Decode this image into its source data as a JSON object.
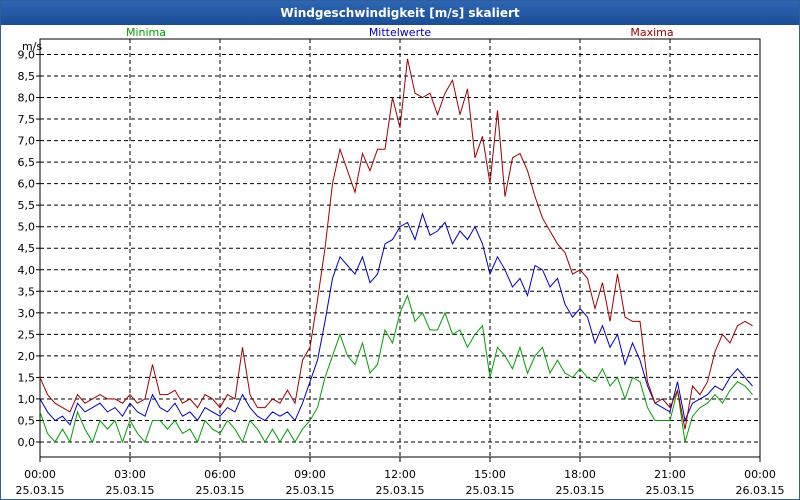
{
  "window": {
    "title": "Windgeschwindigkeit [m/s] skaliert"
  },
  "chart_data": {
    "type": "line",
    "title": "Windgeschwindigkeit [m/s] skaliert",
    "ylabel": "m/s",
    "xlabel": "",
    "ylim": [
      0,
      9.2
    ],
    "xlim": [
      0,
      24
    ],
    "grid": true,
    "legend_position": "top",
    "y_ticks": [
      "0,0",
      "0,5",
      "1,0",
      "1,5",
      "2,0",
      "2,5",
      "3,0",
      "3,5",
      "4,0",
      "4,5",
      "5,0",
      "5,5",
      "6,0",
      "6,5",
      "7,0",
      "7,5",
      "8,0",
      "8,5",
      "9,0"
    ],
    "x_ticks": [
      {
        "time": "00:00",
        "date": "25.03.15"
      },
      {
        "time": "03:00",
        "date": "25.03.15"
      },
      {
        "time": "06:00",
        "date": "25.03.15"
      },
      {
        "time": "09:00",
        "date": "25.03.15"
      },
      {
        "time": "12:00",
        "date": "25.03.15"
      },
      {
        "time": "15:00",
        "date": "25.03.15"
      },
      {
        "time": "18:00",
        "date": "25.03.15"
      },
      {
        "time": "21:00",
        "date": "25.03.15"
      },
      {
        "time": "00:00",
        "date": "26.03.15"
      }
    ],
    "x": [
      0.0,
      0.25,
      0.5,
      0.75,
      1.0,
      1.25,
      1.5,
      1.75,
      2.0,
      2.25,
      2.5,
      2.75,
      3.0,
      3.25,
      3.5,
      3.75,
      4.0,
      4.25,
      4.5,
      4.75,
      5.0,
      5.25,
      5.5,
      5.75,
      6.0,
      6.25,
      6.5,
      6.75,
      7.0,
      7.25,
      7.5,
      7.75,
      8.0,
      8.25,
      8.5,
      8.75,
      9.0,
      9.25,
      9.5,
      9.75,
      10.0,
      10.25,
      10.5,
      10.75,
      11.0,
      11.25,
      11.5,
      11.75,
      12.0,
      12.25,
      12.5,
      12.75,
      13.0,
      13.25,
      13.5,
      13.75,
      14.0,
      14.25,
      14.5,
      14.75,
      15.0,
      15.25,
      15.5,
      15.75,
      16.0,
      16.25,
      16.5,
      16.75,
      17.0,
      17.25,
      17.5,
      17.75,
      18.0,
      18.25,
      18.5,
      18.75,
      19.0,
      19.25,
      19.5,
      19.75,
      20.0,
      20.25,
      20.5,
      20.75,
      21.0,
      21.25,
      21.5,
      21.75,
      22.0,
      22.25,
      22.5,
      22.75,
      23.0,
      23.25,
      23.5,
      23.75
    ],
    "series": [
      {
        "name": "Minima",
        "color": "#00a000",
        "values": [
          0.7,
          0.2,
          0.0,
          0.3,
          0.0,
          0.7,
          0.3,
          0.0,
          0.5,
          0.3,
          0.5,
          0.0,
          0.5,
          0.2,
          0.0,
          0.5,
          0.5,
          0.3,
          0.5,
          0.2,
          0.3,
          0.0,
          0.5,
          0.3,
          0.2,
          0.5,
          0.3,
          0.0,
          0.5,
          0.3,
          0.0,
          0.3,
          0.0,
          0.3,
          0.0,
          0.3,
          0.5,
          0.8,
          1.5,
          2.0,
          2.5,
          2.0,
          1.8,
          2.3,
          1.6,
          1.8,
          2.6,
          2.3,
          3.0,
          3.4,
          2.8,
          3.0,
          2.6,
          2.6,
          3.0,
          2.5,
          2.6,
          2.2,
          2.5,
          2.7,
          1.5,
          2.2,
          2.0,
          1.7,
          2.2,
          1.6,
          2.0,
          2.2,
          1.6,
          1.9,
          1.6,
          1.5,
          1.7,
          1.5,
          1.4,
          1.7,
          1.3,
          1.5,
          1.0,
          1.5,
          1.4,
          0.8,
          0.5,
          0.5,
          0.5,
          1.2,
          0.0,
          0.6,
          0.8,
          0.9,
          1.1,
          0.9,
          1.2,
          1.4,
          1.3,
          1.1,
          0.7,
          0.8,
          0.6,
          0.6
        ]
      },
      {
        "name": "Mittelwerte",
        "color": "#0000c0",
        "values": [
          1.0,
          0.7,
          0.5,
          0.6,
          0.4,
          0.9,
          0.7,
          0.8,
          0.9,
          0.7,
          0.8,
          0.6,
          0.9,
          0.7,
          0.6,
          1.1,
          0.8,
          0.7,
          0.9,
          0.6,
          0.7,
          0.5,
          0.8,
          0.7,
          0.6,
          0.8,
          0.7,
          1.1,
          0.8,
          0.6,
          0.5,
          0.7,
          0.6,
          0.7,
          0.5,
          0.9,
          1.4,
          1.9,
          2.8,
          3.8,
          4.3,
          4.1,
          3.9,
          4.3,
          3.7,
          3.9,
          4.6,
          4.7,
          5.0,
          5.1,
          4.7,
          5.3,
          4.8,
          4.9,
          5.1,
          4.6,
          4.9,
          4.7,
          5.0,
          4.6,
          3.9,
          4.3,
          4.0,
          3.6,
          3.8,
          3.4,
          4.1,
          4.0,
          3.6,
          3.8,
          3.2,
          2.9,
          3.1,
          2.9,
          2.3,
          2.7,
          2.2,
          2.5,
          1.8,
          2.3,
          1.9,
          1.3,
          0.9,
          0.8,
          0.7,
          1.4,
          0.5,
          0.9,
          1.0,
          1.1,
          1.3,
          1.2,
          1.5,
          1.7,
          1.5,
          1.3,
          1.4,
          1.7,
          1.6,
          1.4
        ]
      },
      {
        "name": "Maxima",
        "color": "#a00000",
        "values": [
          1.5,
          1.1,
          0.9,
          0.8,
          0.7,
          1.1,
          0.9,
          1.0,
          1.1,
          1.0,
          1.0,
          0.9,
          1.1,
          0.9,
          1.0,
          1.8,
          1.1,
          1.1,
          1.2,
          0.9,
          1.0,
          0.8,
          1.1,
          1.0,
          0.8,
          1.1,
          1.0,
          2.2,
          1.1,
          0.8,
          0.8,
          1.0,
          0.9,
          1.2,
          0.9,
          1.9,
          2.2,
          3.3,
          4.5,
          6.0,
          6.8,
          6.3,
          5.8,
          6.7,
          6.3,
          6.8,
          6.8,
          8.0,
          7.3,
          8.9,
          8.1,
          8.0,
          8.1,
          7.6,
          8.1,
          8.4,
          7.6,
          8.2,
          6.6,
          7.1,
          6.0,
          7.7,
          5.7,
          6.6,
          6.7,
          6.3,
          5.7,
          5.2,
          4.9,
          4.6,
          4.4,
          3.9,
          4.0,
          3.8,
          3.1,
          3.7,
          2.8,
          3.9,
          2.9,
          2.8,
          2.8,
          1.4,
          0.9,
          1.0,
          0.8,
          1.2,
          0.3,
          1.3,
          1.1,
          1.4,
          2.1,
          2.5,
          2.3,
          2.7,
          2.8,
          2.7,
          2.9,
          2.4,
          2.7,
          2.4
        ]
      }
    ]
  }
}
